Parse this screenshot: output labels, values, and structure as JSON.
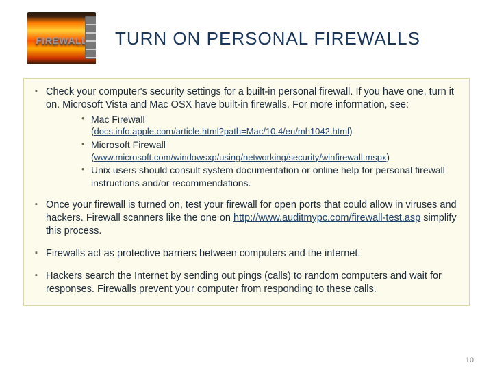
{
  "title": "TURN ON PERSONAL FIREWALLS",
  "image_alt": "FIREWALL",
  "bullets": {
    "b1": {
      "text": "Check your computer's security settings for a built-in personal firewall. If you have one, turn it on. Microsoft Vista and Mac OSX have built-in firewalls. For more information, see:",
      "sub": {
        "mac": {
          "label": "Mac Firewall",
          "paren_open": "(",
          "link": "docs.info.apple.com/article.html?path=Mac/10.4/en/mh1042.html",
          "paren_close": ")"
        },
        "ms": {
          "label": "Microsoft Firewall",
          "paren_open": "(",
          "link": "www.microsoft.com/windowsxp/using/networking/security/winfirewall.mspx",
          "paren_close": ")"
        },
        "unix": "Unix users should consult system documentation or online help for personal firewall instructions and/or recommendations."
      }
    },
    "b2": {
      "pre": "Once your firewall is turned on, test your firewall for open ports that could allow in viruses and hackers. Firewall scanners like the one on ",
      "link": "http://www.auditmypc.com/firewall-test.asp",
      "post": " simplify this process."
    },
    "b3": "Firewalls act as protective barriers between computers and the internet.",
    "b4": "Hackers search the Internet by sending out pings (calls) to random computers and wait for responses. Firewalls prevent your computer from responding to these calls."
  },
  "page_number": "10"
}
